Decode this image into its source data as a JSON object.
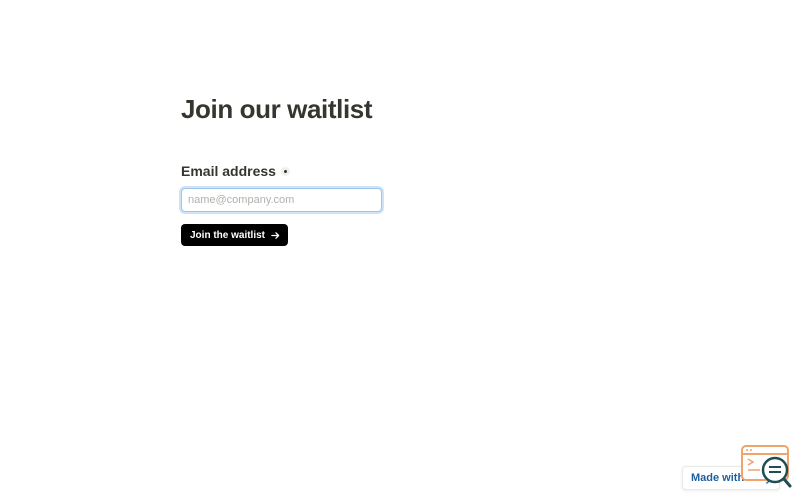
{
  "form": {
    "title": "Join our waitlist",
    "email_label": "Email address",
    "email_placeholder": "name@company.com",
    "email_value": "",
    "submit_label": "Join the waitlist"
  },
  "badge": {
    "label": "Made with Tally"
  },
  "icons": {
    "required": "required-dot-icon",
    "submit_arrow": "arrow-right-icon",
    "widget": "magnifier-icon"
  },
  "colors": {
    "text": "#37352f",
    "button_bg": "#000000",
    "input_focus": "#9cc6ec",
    "badge_text": "#1f5f9e",
    "widget_accent": "#f0a36a",
    "widget_dark": "#1e4d55"
  }
}
